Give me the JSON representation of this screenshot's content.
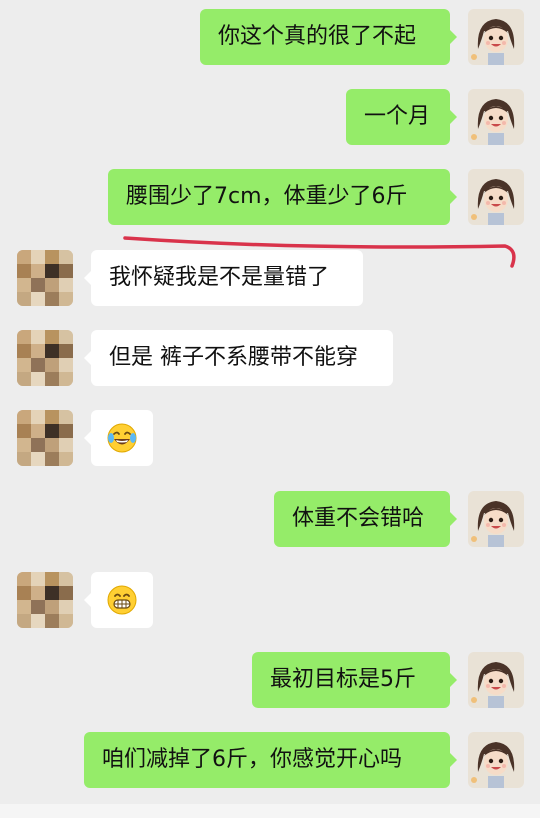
{
  "messages": [
    {
      "side": "me",
      "text": "你这个真的很了不起"
    },
    {
      "side": "me",
      "text": "一个月"
    },
    {
      "side": "me",
      "text": "腰围少了7cm，体重少了6斤"
    },
    {
      "side": "other",
      "text": "我怀疑我是不是量错了"
    },
    {
      "side": "other",
      "text": "但是 裤子不系腰带不能穿"
    },
    {
      "side": "other",
      "emoji": "laughing-tears"
    },
    {
      "side": "me",
      "text": "体重不会错哈"
    },
    {
      "side": "other",
      "emoji": "grinning"
    },
    {
      "side": "me",
      "text": "最初目标是5斤"
    },
    {
      "side": "me",
      "text": "咱们减掉了6斤，你感觉开心吗"
    }
  ],
  "colors": {
    "background": "#ededed",
    "my_bubble": "#95ec69",
    "other_bubble": "#ffffff",
    "annotation_underline": "#d9334b"
  }
}
